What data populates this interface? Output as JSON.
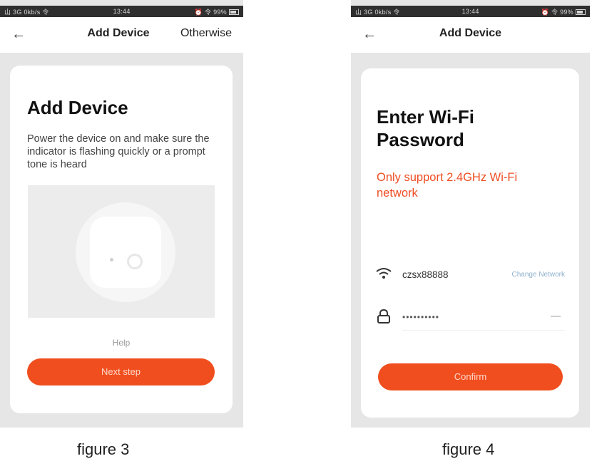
{
  "figure3": {
    "status_left": "山 3G 0kb/s 令",
    "status_time": "13:44",
    "status_right": "⏰ 令 99%",
    "back_icon": "arrow-left-icon",
    "title": "Add Device",
    "otherwise": "Otherwise",
    "heading": "Add Device",
    "description": "Power the device on and make sure the indicator is flashing quickly or a prompt tone is heard",
    "help_link": "Help",
    "next_button": "Next step",
    "caption": "figure 3"
  },
  "figure4": {
    "status_left": "山 3G 0kb/s 令",
    "status_time": "13:44",
    "status_right": "⏰ 令 99%",
    "back_icon": "arrow-left-icon",
    "title": "Add Device",
    "heading": "Enter Wi-Fi Password",
    "support_note": "Only support 2.4GHz Wi-Fi network",
    "wifi_ssid": "czsx88888",
    "change_network": "Change Network",
    "password_value": "••••••••••",
    "confirm_button": "Confirm",
    "caption": "figure 4"
  },
  "colors": {
    "accent": "#f04e1e",
    "support_note": "#ee4d22",
    "status_bar": "#2f2f2f",
    "phone_background": "#e6e6e6"
  },
  "icons": [
    "arrow-left-icon",
    "wifi-icon",
    "lock-icon",
    "eye-toggle-icon"
  ]
}
